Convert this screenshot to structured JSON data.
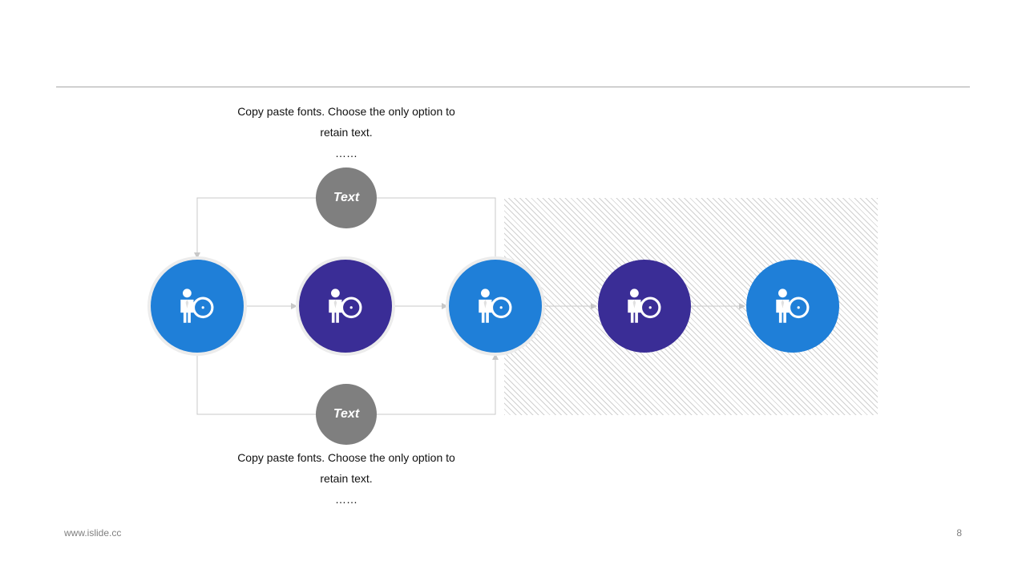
{
  "notes": {
    "top": {
      "line1": "Copy paste fonts. Choose the only option to",
      "line2": "retain text.",
      "ellipsis": "……"
    },
    "bottom": {
      "line1": "Copy paste fonts. Choose the only option to",
      "line2": "retain text.",
      "ellipsis": "……"
    }
  },
  "labels": {
    "top": "Text",
    "bottom": "Text"
  },
  "nodes": [
    {
      "icon": "businessman-compass-icon",
      "color": "#1f7fd8"
    },
    {
      "icon": "businessman-compass-icon",
      "color": "#3a2d96"
    },
    {
      "icon": "businessman-compass-icon",
      "color": "#1f7fd8"
    },
    {
      "icon": "businessman-compass-icon",
      "color": "#3a2d96"
    },
    {
      "icon": "businessman-compass-icon",
      "color": "#1f7fd8"
    }
  ],
  "footer": {
    "url": "www.islide.cc",
    "page": "8"
  },
  "colors": {
    "blue": "#1f7fd8",
    "purple": "#3a2d96",
    "gray": "#7f7f7f",
    "connector": "#c8c8c8"
  }
}
